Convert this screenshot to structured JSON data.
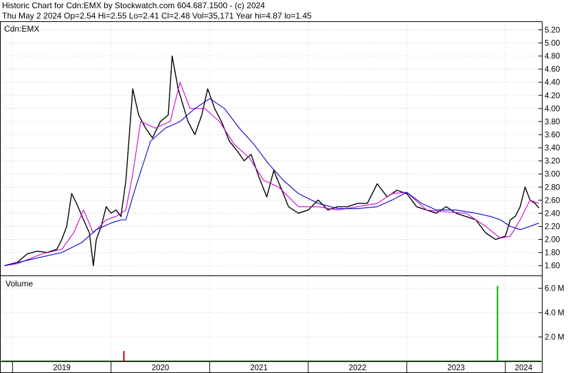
{
  "header": {
    "line1": "Historic Chart for Cdn:EMX by Stockwatch.com 604.687.1500 - (c) 2024",
    "line2": "Thu May  2 2024   Op=2.54  Hi=2.55  Lo=2.41  Cl=2.48  Vol=35,171  Year hi=4.87  lo=1.45"
  },
  "chart_data": [
    {
      "type": "line",
      "title": "Cdn:EMX",
      "ylim": [
        1.45,
        5.32
      ],
      "y_ticks": [
        "5.20",
        "5.00",
        "4.80",
        "4.60",
        "4.40",
        "4.20",
        "4.00",
        "3.80",
        "3.60",
        "3.40",
        "3.20",
        "3.00",
        "2.80",
        "2.60",
        "2.40",
        "2.20",
        "2.00",
        "1.80",
        "1.60"
      ],
      "x_ticks": [
        "2019",
        "2020",
        "2021",
        "2022",
        "2023",
        "2024"
      ],
      "grid": true,
      "colors": {
        "price": "#000000",
        "ma_short": "#cc00cc",
        "ma_long": "#0000cc"
      },
      "series": [
        {
          "role": "price",
          "x": [
            2018.92,
            2018.97,
            2019.05,
            2019.15,
            2019.25,
            2019.35,
            2019.45,
            2019.5,
            2019.55,
            2019.6,
            2019.65,
            2019.72,
            2019.78,
            2019.82,
            2019.85,
            2019.9,
            2019.95,
            2020.0,
            2020.05,
            2020.1,
            2020.15,
            2020.18,
            2020.22,
            2020.28,
            2020.35,
            2020.42,
            2020.5,
            2020.58,
            2020.62,
            2020.68,
            2020.72,
            2020.78,
            2020.85,
            2020.92,
            2020.98,
            2021.05,
            2021.12,
            2021.2,
            2021.28,
            2021.35,
            2021.42,
            2021.5,
            2021.58,
            2021.65,
            2021.72,
            2021.8,
            2021.9,
            2022.0,
            2022.1,
            2022.2,
            2022.3,
            2022.4,
            2022.5,
            2022.6,
            2022.7,
            2022.8,
            2022.9,
            2023.0,
            2023.1,
            2023.2,
            2023.3,
            2023.4,
            2023.5,
            2023.6,
            2023.7,
            2023.8,
            2023.9,
            2024.0,
            2024.05,
            2024.1,
            2024.15,
            2024.2,
            2024.25,
            2024.3,
            2024.34
          ],
          "y": [
            1.6,
            1.62,
            1.65,
            1.78,
            1.82,
            1.8,
            1.85,
            2.0,
            2.2,
            2.7,
            2.55,
            2.3,
            2.1,
            1.6,
            2.0,
            2.2,
            2.5,
            2.4,
            2.45,
            2.35,
            2.9,
            3.5,
            4.3,
            3.9,
            3.7,
            3.55,
            3.8,
            3.9,
            4.8,
            4.3,
            4.1,
            3.8,
            3.6,
            3.9,
            4.3,
            4.0,
            3.8,
            3.5,
            3.35,
            3.2,
            3.3,
            2.95,
            2.65,
            3.05,
            2.8,
            2.5,
            2.4,
            2.45,
            2.6,
            2.45,
            2.5,
            2.5,
            2.55,
            2.55,
            2.85,
            2.65,
            2.75,
            2.7,
            2.5,
            2.45,
            2.4,
            2.5,
            2.4,
            2.35,
            2.3,
            2.1,
            2.0,
            2.05,
            2.3,
            2.35,
            2.5,
            2.8,
            2.6,
            2.55,
            2.48
          ]
        },
        {
          "role": "ma_short",
          "x": [
            2018.92,
            2019.05,
            2019.3,
            2019.5,
            2019.62,
            2019.72,
            2019.82,
            2019.95,
            2020.05,
            2020.15,
            2020.22,
            2020.3,
            2020.45,
            2020.6,
            2020.7,
            2020.8,
            2020.95,
            2021.1,
            2021.25,
            2021.4,
            2021.55,
            2021.7,
            2021.9,
            2022.1,
            2022.3,
            2022.5,
            2022.7,
            2022.85,
            2023.0,
            2023.2,
            2023.4,
            2023.6,
            2023.8,
            2023.95,
            2024.05,
            2024.15,
            2024.25,
            2024.34
          ],
          "y": [
            1.6,
            1.63,
            1.78,
            1.85,
            2.1,
            2.45,
            2.1,
            2.3,
            2.35,
            2.45,
            3.0,
            3.8,
            3.7,
            3.8,
            4.4,
            4.0,
            4.0,
            3.8,
            3.45,
            3.25,
            2.9,
            2.8,
            2.5,
            2.5,
            2.45,
            2.5,
            2.55,
            2.7,
            2.72,
            2.45,
            2.42,
            2.4,
            2.2,
            2.02,
            2.05,
            2.3,
            2.6,
            2.55
          ]
        },
        {
          "role": "ma_long",
          "x": [
            2018.92,
            2019.2,
            2019.5,
            2019.7,
            2019.85,
            2020.0,
            2020.1,
            2020.15,
            2020.25,
            2020.4,
            2020.55,
            2020.7,
            2020.85,
            2021.0,
            2021.15,
            2021.3,
            2021.45,
            2021.6,
            2021.75,
            2021.9,
            2022.1,
            2022.3,
            2022.5,
            2022.7,
            2022.85,
            2023.0,
            2023.15,
            2023.3,
            2023.5,
            2023.7,
            2023.85,
            2023.95,
            2024.05,
            2024.15,
            2024.25,
            2024.34
          ],
          "y": [
            1.6,
            1.7,
            1.8,
            1.95,
            2.15,
            2.25,
            2.3,
            2.3,
            2.8,
            3.5,
            3.7,
            3.8,
            4.0,
            4.15,
            4.0,
            3.7,
            3.45,
            3.15,
            2.9,
            2.7,
            2.55,
            2.47,
            2.47,
            2.5,
            2.6,
            2.72,
            2.55,
            2.45,
            2.45,
            2.4,
            2.35,
            2.3,
            2.2,
            2.15,
            2.2,
            2.25
          ]
        }
      ]
    },
    {
      "type": "bar",
      "title": "Volume",
      "ylim": [
        0,
        7.0
      ],
      "y_ticks": [
        "6.0 M",
        "4.0 M",
        "2.0 M"
      ],
      "colors": {
        "up": "#00aa00",
        "down": "#cc0000"
      },
      "baseline_volume": 0.08,
      "x": [
        2020.13,
        2023.92
      ],
      "values": [
        0.85,
        6.2
      ],
      "bar_colors": [
        "#cc0000",
        "#00aa00"
      ]
    }
  ]
}
